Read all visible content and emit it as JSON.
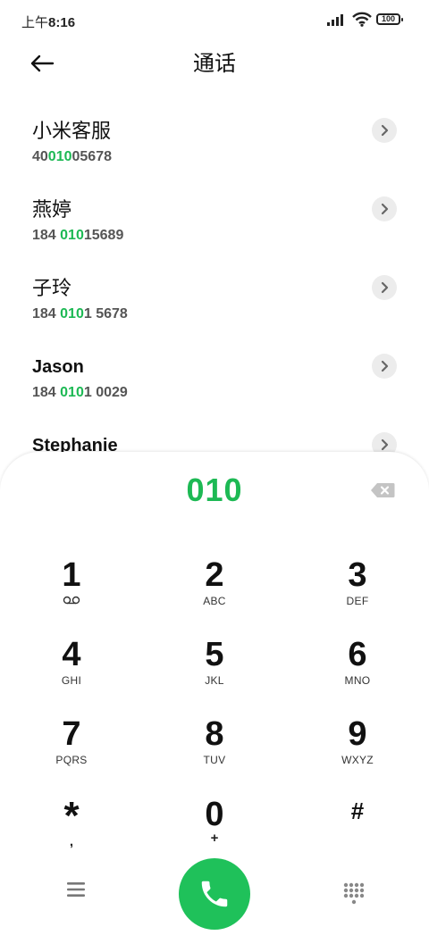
{
  "status_bar": {
    "time_prefix": "上午",
    "time": "8:16",
    "battery": "100",
    "signal_icon": "signal-icon",
    "wifi_icon": "wifi-icon"
  },
  "header": {
    "title": "通话",
    "back_icon": "arrow-left-icon"
  },
  "contacts": [
    {
      "name": "小米客服",
      "number_pre": "40",
      "number_match": "010",
      "number_post": "05678"
    },
    {
      "name": "燕婷",
      "number_pre": "184 ",
      "number_match": "010",
      "number_post": "15689"
    },
    {
      "name": "子玲",
      "number_pre": "184 ",
      "number_match": "010",
      "number_post": "1 5678"
    },
    {
      "name": "Jason",
      "number_pre": "184 ",
      "number_match": "010",
      "number_post": "1 0029"
    },
    {
      "name": "Stephanie",
      "number_pre": "",
      "number_match": "",
      "number_post": ""
    }
  ],
  "dialer": {
    "dialed_number": "010",
    "keys": [
      {
        "digit": "1",
        "letters": ""
      },
      {
        "digit": "2",
        "letters": "ABC"
      },
      {
        "digit": "3",
        "letters": "DEF"
      },
      {
        "digit": "4",
        "letters": "GHI"
      },
      {
        "digit": "5",
        "letters": "JKL"
      },
      {
        "digit": "6",
        "letters": "MNO"
      },
      {
        "digit": "7",
        "letters": "PQRS"
      },
      {
        "digit": "8",
        "letters": "TUV"
      },
      {
        "digit": "9",
        "letters": "WXYZ"
      },
      {
        "digit": "*",
        "letters": ","
      },
      {
        "digit": "0",
        "letters": "+"
      },
      {
        "digit": "#",
        "letters": ""
      }
    ],
    "call_color": "#1fc15a",
    "accent_color": "#1db954"
  }
}
